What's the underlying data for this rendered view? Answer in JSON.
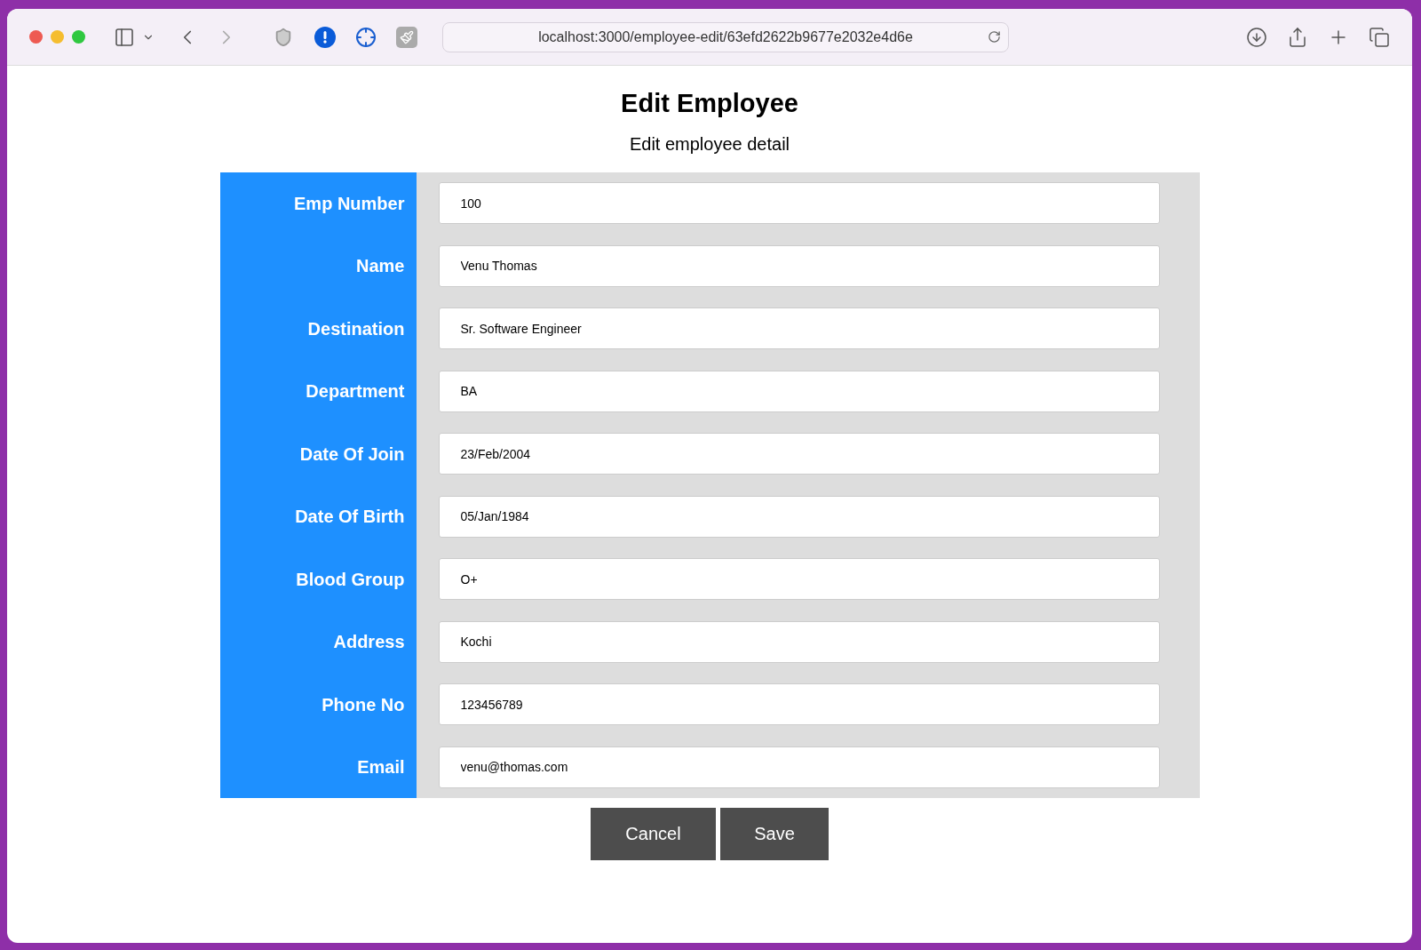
{
  "browser": {
    "url": "localhost:3000/employee-edit/63efd2622b9677e2032e4d6e"
  },
  "page": {
    "title": "Edit Employee",
    "subtitle": "Edit employee detail"
  },
  "form": {
    "fields": [
      {
        "label": "Emp Number",
        "value": "100"
      },
      {
        "label": "Name",
        "value": "Venu Thomas"
      },
      {
        "label": "Destination",
        "value": "Sr. Software Engineer"
      },
      {
        "label": "Department",
        "value": "BA"
      },
      {
        "label": "Date Of Join",
        "value": "23/Feb/2004"
      },
      {
        "label": "Date Of Birth",
        "value": "05/Jan/1984"
      },
      {
        "label": "Blood Group",
        "value": "O+"
      },
      {
        "label": "Address",
        "value": "Kochi"
      },
      {
        "label": "Phone No",
        "value": "123456789"
      },
      {
        "label": "Email",
        "value": "venu@thomas.com"
      }
    ],
    "buttons": [
      "Cancel",
      "Save"
    ]
  }
}
